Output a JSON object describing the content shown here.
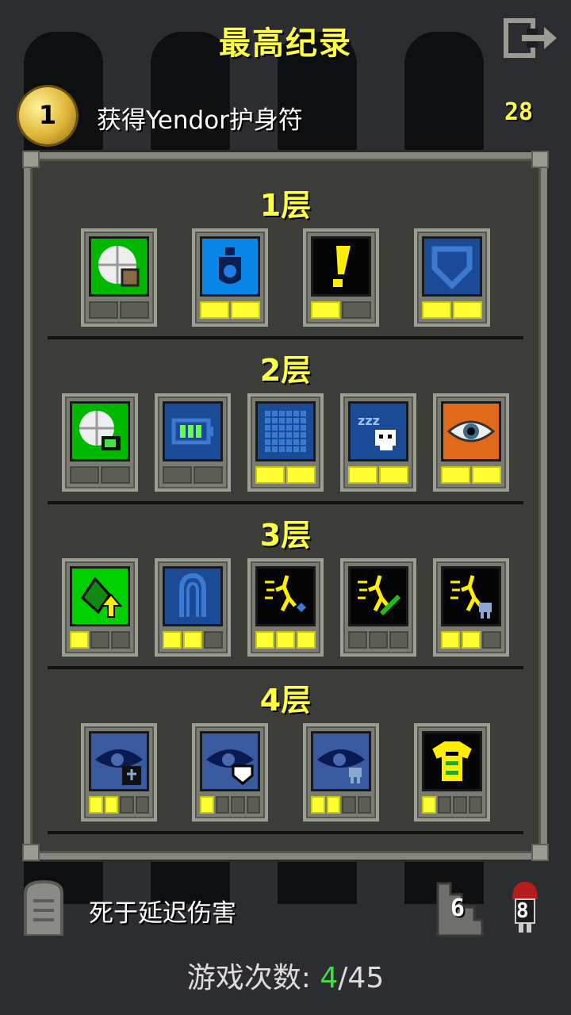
{
  "header": {
    "title": "最高纪录",
    "exit_icon": "exit-icon"
  },
  "record": {
    "challenge_count": "1",
    "challenge_text": "获得Yendor护身符",
    "score": "28"
  },
  "floors": [
    {
      "label": "1层",
      "badges": [
        {
          "icon": "food-icon",
          "bg": "#00b800",
          "pips": 2,
          "lit": 0
        },
        {
          "icon": "water-flask-icon",
          "bg": "#0a86e8",
          "pips": 2,
          "lit": 2
        },
        {
          "icon": "exclamation-icon",
          "bg": "#050505",
          "pips": 2,
          "lit": 1
        },
        {
          "icon": "shield-icon",
          "bg": "#1b4a96",
          "pips": 2,
          "lit": 2
        }
      ]
    },
    {
      "label": "2层",
      "badges": [
        {
          "icon": "food-battery-icon",
          "bg": "#00b800",
          "pips": 2,
          "lit": 0
        },
        {
          "icon": "battery-icon",
          "bg": "#1b4a96",
          "pips": 2,
          "lit": 0
        },
        {
          "icon": "grid-icon",
          "bg": "#1b4a96",
          "pips": 2,
          "lit": 2
        },
        {
          "icon": "sleep-skull-icon",
          "bg": "#1b4a96",
          "pips": 2,
          "lit": 2
        },
        {
          "icon": "eye-icon",
          "bg": "#e06a1c",
          "pips": 2,
          "lit": 2
        }
      ]
    },
    {
      "label": "3层",
      "badges": [
        {
          "icon": "plant-upgrade-icon",
          "bg": "#00d000",
          "pips": 3,
          "lit": 1
        },
        {
          "icon": "keyhole-icon",
          "bg": "#1b4a96",
          "pips": 3,
          "lit": 2
        },
        {
          "icon": "hero-magic-icon",
          "bg": "#050505",
          "pips": 3,
          "lit": 3
        },
        {
          "icon": "hero-green-icon",
          "bg": "#050505",
          "pips": 3,
          "lit": 0
        },
        {
          "icon": "hero-skull-icon",
          "bg": "#050505",
          "pips": 3,
          "lit": 2
        }
      ]
    },
    {
      "label": "4层",
      "badges": [
        {
          "icon": "dark-eye-figure-icon",
          "bg": "#3a5aa0",
          "pips": 4,
          "lit": 2
        },
        {
          "icon": "dark-eye-shield-icon",
          "bg": "#3a5aa0",
          "pips": 4,
          "lit": 1
        },
        {
          "icon": "dark-eye-skull-icon",
          "bg": "#3a5aa0",
          "pips": 4,
          "lit": 2
        },
        {
          "icon": "armor-icon",
          "bg": "#050505",
          "pips": 4,
          "lit": 1
        }
      ]
    }
  ],
  "footer": {
    "death_cause": "死于延迟伤害",
    "tombstone_icon": "tombstone-icon",
    "depth": "6",
    "depth_icon": "depth-icon",
    "level": "8",
    "level_icon": "hero-level-icon",
    "games_label": "游戏次数:",
    "games_current": "4",
    "games_total": "/45"
  }
}
